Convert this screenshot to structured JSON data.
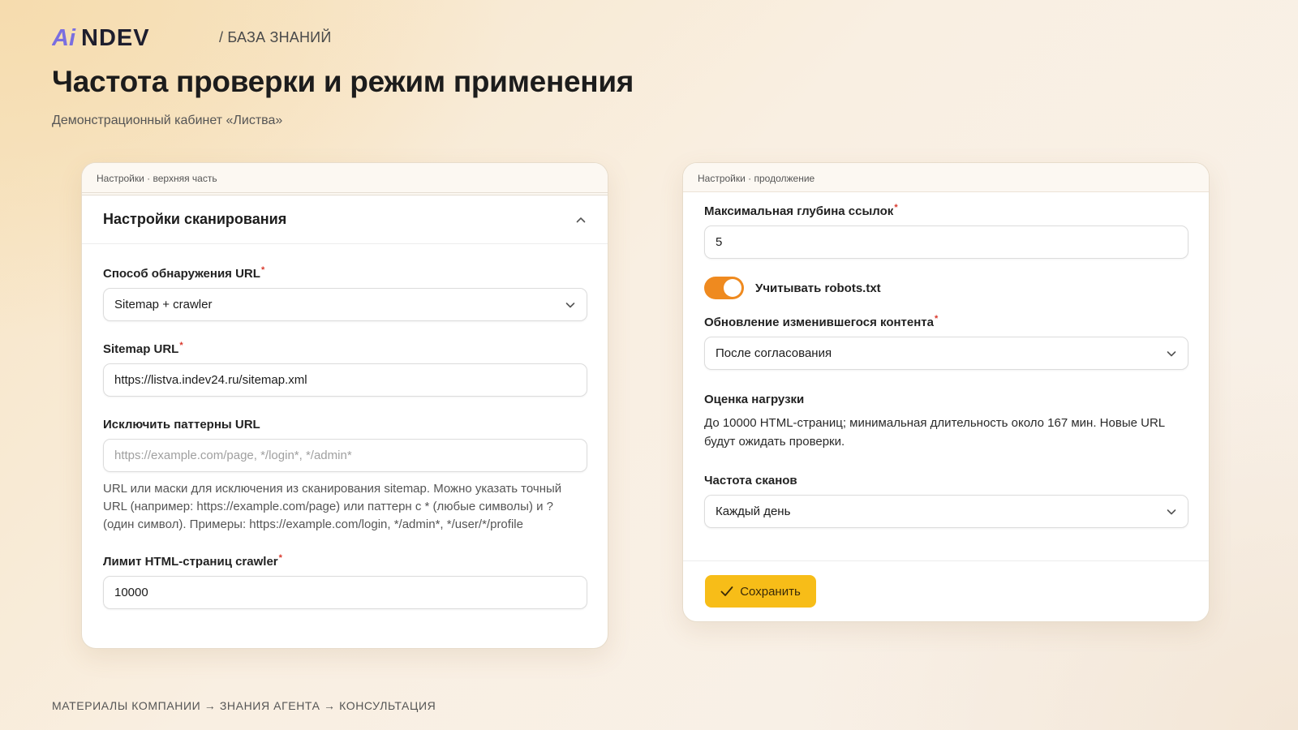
{
  "header": {
    "logo_text": "AiNDEV",
    "breadcrumb": "/ БАЗА ЗНАНИЙ",
    "title": "Частота проверки и режим применения",
    "subtitle": "Демонстрационный кабинет «Листва»"
  },
  "left_card": {
    "caption": "Настройки · верхняя часть",
    "section_title": "Настройки сканирования",
    "discovery": {
      "label": "Способ обнаружения URL",
      "value": "Sitemap + crawler"
    },
    "sitemap": {
      "label": "Sitemap URL",
      "value": "https://listva.indev24.ru/sitemap.xml"
    },
    "exclude": {
      "label": "Исключить паттерны URL",
      "placeholder": "https://example.com/page, */login*, */admin*",
      "hint": "URL или маски для исключения из сканирования sitemap. Можно указать точный URL (например: https://example.com/page) или паттерн с * (любые символы) и ? (один символ). Примеры: https://example.com/login, */admin*, */user/*/profile"
    },
    "limit": {
      "label": "Лимит HTML-страниц crawler",
      "value": "10000"
    },
    "required_mark": "*"
  },
  "right_card": {
    "caption": "Настройки · продолжение",
    "depth": {
      "label": "Максимальная глубина ссылок",
      "value": "5"
    },
    "robots": {
      "label": "Учитывать robots.txt",
      "enabled": true
    },
    "update": {
      "label": "Обновление изменившегося контента",
      "value": "После согласования"
    },
    "load": {
      "label": "Оценка нагрузки",
      "text": "До 10000 HTML-страниц; минимальная длительность около 167 мин. Новые URL будут ожидать проверки."
    },
    "frequency": {
      "label": "Частота сканов",
      "value": "Каждый день"
    },
    "save_label": "Сохранить",
    "required_mark": "*"
  },
  "footer_nav": "МАТЕРИАЛЫ КОМПАНИИ → ЗНАНИЯ АГЕНТА → КОНСУЛЬТАЦИЯ",
  "colors": {
    "accent": "#f7bd18",
    "toggle": "#ef8a1f",
    "required": "#d9382c",
    "logo": "#6f5fd6"
  }
}
